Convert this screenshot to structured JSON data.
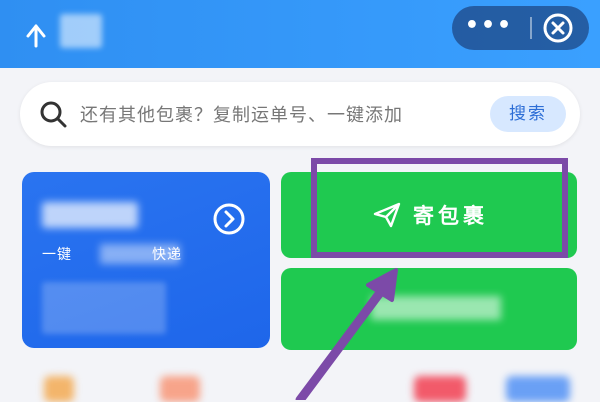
{
  "header": {
    "more_label": "•••",
    "back_icon": "back-arrow-icon",
    "close_icon": "close-circle-icon"
  },
  "search": {
    "placeholder": "还有其他包裹？复制运单号、一键添加",
    "button_label": "搜索"
  },
  "cards": {
    "left": {
      "subtitle_prefix": "一键",
      "subtitle_suffix": "快递"
    },
    "send": {
      "label": "寄包裹",
      "icon": "paper-plane-icon"
    }
  },
  "colors": {
    "header": "#3aa0ff",
    "green": "#1fc950",
    "blue_card": "#1e66ea",
    "highlight": "#7c4aa8"
  }
}
